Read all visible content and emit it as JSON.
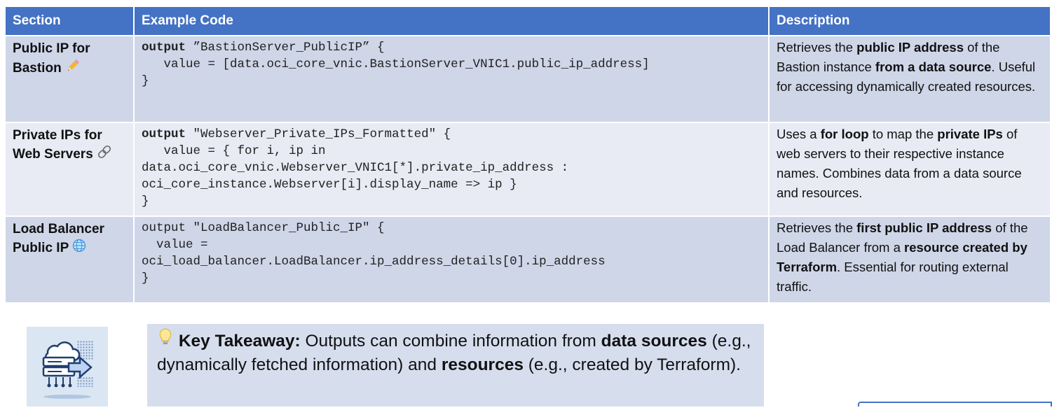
{
  "table": {
    "headers": [
      "Section",
      "Example Code",
      "Description"
    ],
    "rows": [
      {
        "section": [
          "Public IP for",
          "Bastion"
        ],
        "section_icon": "pencil-icon",
        "code": {
          "kw": "output",
          "l1": " ”BastionServer_PublicIP” {",
          "l2": "   value = [data.oci_core_vnic.BastionServer_VNIC1.public_ip_address]",
          "l3": "}"
        },
        "desc": {
          "p1": "Retrieves the ",
          "b1": "public IP address",
          "p2": " of the Bastion instance ",
          "b2": "from a data source",
          "p3": ". Useful for accessing dynamically created resources."
        }
      },
      {
        "section": [
          "Private IPs for",
          "Web Servers"
        ],
        "section_icon": "link-icon",
        "code": {
          "kw": "output",
          "l1": " \"Webserver_Private_IPs_Formatted\" {",
          "l2": "   value = { for i, ip in",
          "l3": "data.oci_core_vnic.Webserver_VNIC1[*].private_ip_address :",
          "l4": "oci_core_instance.Webserver[i].display_name => ip }",
          "l5": "}"
        },
        "desc": {
          "p1": "Uses a ",
          "b1": "for loop",
          "p2": " to map the ",
          "b2": "private IPs",
          "p3": " of web servers to their respective instance names. Combines data from a data source and resources."
        }
      },
      {
        "section": [
          "Load Balancer",
          "Public IP"
        ],
        "section_icon": "globe-icon",
        "code": {
          "l1": "output \"LoadBalancer_Public_IP\" {",
          "l2": "  value =",
          "l3": "oci_load_balancer.LoadBalancer.ip_address_details[0].ip_address",
          "l4": "}"
        },
        "desc": {
          "p1": "Retrieves the ",
          "b1": "first public IP address",
          "p2": " of the Load Balancer from a ",
          "b2": "resource created by Terraform",
          "p3": ". Essential for routing external traffic."
        }
      }
    ]
  },
  "takeaway": {
    "icon": "lightbulb-icon",
    "label": "Key Takeaway:",
    "t1": " Outputs can combine information from ",
    "b1": "data sources",
    "t2": " (e.g., dynamically fetched information) and ",
    "b2": "resources",
    "t3": " (e.g., created by Terraform)."
  },
  "illustration": {
    "icon": "cloud-server-transfer-icon"
  },
  "colors": {
    "header": "#4472c4",
    "row_dark": "#cfd6e8",
    "row_light": "#e8ebf4",
    "takeaway_bg": "#d6deee"
  }
}
